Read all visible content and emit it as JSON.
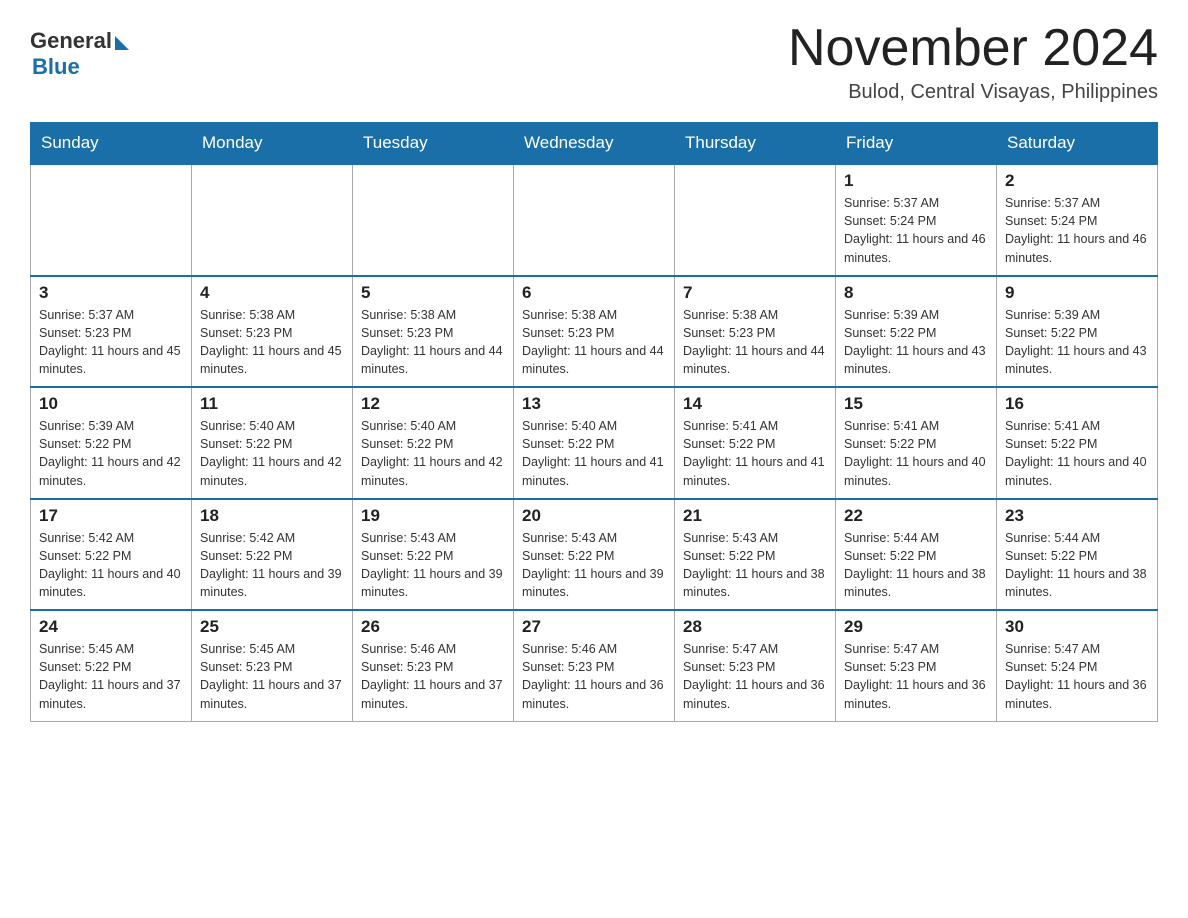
{
  "header": {
    "logo_general": "General",
    "logo_blue": "Blue",
    "month_title": "November 2024",
    "location": "Bulod, Central Visayas, Philippines"
  },
  "weekdays": [
    "Sunday",
    "Monday",
    "Tuesday",
    "Wednesday",
    "Thursday",
    "Friday",
    "Saturday"
  ],
  "weeks": [
    [
      {
        "day": "",
        "info": ""
      },
      {
        "day": "",
        "info": ""
      },
      {
        "day": "",
        "info": ""
      },
      {
        "day": "",
        "info": ""
      },
      {
        "day": "",
        "info": ""
      },
      {
        "day": "1",
        "info": "Sunrise: 5:37 AM\nSunset: 5:24 PM\nDaylight: 11 hours and 46 minutes."
      },
      {
        "day": "2",
        "info": "Sunrise: 5:37 AM\nSunset: 5:24 PM\nDaylight: 11 hours and 46 minutes."
      }
    ],
    [
      {
        "day": "3",
        "info": "Sunrise: 5:37 AM\nSunset: 5:23 PM\nDaylight: 11 hours and 45 minutes."
      },
      {
        "day": "4",
        "info": "Sunrise: 5:38 AM\nSunset: 5:23 PM\nDaylight: 11 hours and 45 minutes."
      },
      {
        "day": "5",
        "info": "Sunrise: 5:38 AM\nSunset: 5:23 PM\nDaylight: 11 hours and 44 minutes."
      },
      {
        "day": "6",
        "info": "Sunrise: 5:38 AM\nSunset: 5:23 PM\nDaylight: 11 hours and 44 minutes."
      },
      {
        "day": "7",
        "info": "Sunrise: 5:38 AM\nSunset: 5:23 PM\nDaylight: 11 hours and 44 minutes."
      },
      {
        "day": "8",
        "info": "Sunrise: 5:39 AM\nSunset: 5:22 PM\nDaylight: 11 hours and 43 minutes."
      },
      {
        "day": "9",
        "info": "Sunrise: 5:39 AM\nSunset: 5:22 PM\nDaylight: 11 hours and 43 minutes."
      }
    ],
    [
      {
        "day": "10",
        "info": "Sunrise: 5:39 AM\nSunset: 5:22 PM\nDaylight: 11 hours and 42 minutes."
      },
      {
        "day": "11",
        "info": "Sunrise: 5:40 AM\nSunset: 5:22 PM\nDaylight: 11 hours and 42 minutes."
      },
      {
        "day": "12",
        "info": "Sunrise: 5:40 AM\nSunset: 5:22 PM\nDaylight: 11 hours and 42 minutes."
      },
      {
        "day": "13",
        "info": "Sunrise: 5:40 AM\nSunset: 5:22 PM\nDaylight: 11 hours and 41 minutes."
      },
      {
        "day": "14",
        "info": "Sunrise: 5:41 AM\nSunset: 5:22 PM\nDaylight: 11 hours and 41 minutes."
      },
      {
        "day": "15",
        "info": "Sunrise: 5:41 AM\nSunset: 5:22 PM\nDaylight: 11 hours and 40 minutes."
      },
      {
        "day": "16",
        "info": "Sunrise: 5:41 AM\nSunset: 5:22 PM\nDaylight: 11 hours and 40 minutes."
      }
    ],
    [
      {
        "day": "17",
        "info": "Sunrise: 5:42 AM\nSunset: 5:22 PM\nDaylight: 11 hours and 40 minutes."
      },
      {
        "day": "18",
        "info": "Sunrise: 5:42 AM\nSunset: 5:22 PM\nDaylight: 11 hours and 39 minutes."
      },
      {
        "day": "19",
        "info": "Sunrise: 5:43 AM\nSunset: 5:22 PM\nDaylight: 11 hours and 39 minutes."
      },
      {
        "day": "20",
        "info": "Sunrise: 5:43 AM\nSunset: 5:22 PM\nDaylight: 11 hours and 39 minutes."
      },
      {
        "day": "21",
        "info": "Sunrise: 5:43 AM\nSunset: 5:22 PM\nDaylight: 11 hours and 38 minutes."
      },
      {
        "day": "22",
        "info": "Sunrise: 5:44 AM\nSunset: 5:22 PM\nDaylight: 11 hours and 38 minutes."
      },
      {
        "day": "23",
        "info": "Sunrise: 5:44 AM\nSunset: 5:22 PM\nDaylight: 11 hours and 38 minutes."
      }
    ],
    [
      {
        "day": "24",
        "info": "Sunrise: 5:45 AM\nSunset: 5:22 PM\nDaylight: 11 hours and 37 minutes."
      },
      {
        "day": "25",
        "info": "Sunrise: 5:45 AM\nSunset: 5:23 PM\nDaylight: 11 hours and 37 minutes."
      },
      {
        "day": "26",
        "info": "Sunrise: 5:46 AM\nSunset: 5:23 PM\nDaylight: 11 hours and 37 minutes."
      },
      {
        "day": "27",
        "info": "Sunrise: 5:46 AM\nSunset: 5:23 PM\nDaylight: 11 hours and 36 minutes."
      },
      {
        "day": "28",
        "info": "Sunrise: 5:47 AM\nSunset: 5:23 PM\nDaylight: 11 hours and 36 minutes."
      },
      {
        "day": "29",
        "info": "Sunrise: 5:47 AM\nSunset: 5:23 PM\nDaylight: 11 hours and 36 minutes."
      },
      {
        "day": "30",
        "info": "Sunrise: 5:47 AM\nSunset: 5:24 PM\nDaylight: 11 hours and 36 minutes."
      }
    ]
  ]
}
